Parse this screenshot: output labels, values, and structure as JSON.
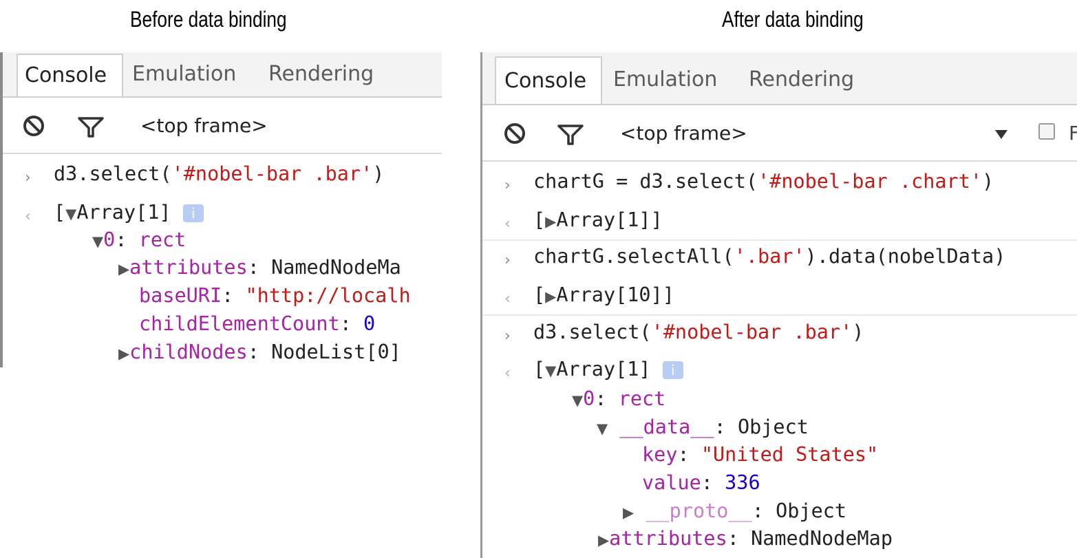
{
  "captions": {
    "before": "Before data binding",
    "after": "After data binding"
  },
  "tabs": [
    "Console",
    "Emulation",
    "Rendering"
  ],
  "toolbar": {
    "frame": "<top frame>",
    "icons": [
      "clear-console-icon",
      "filter-icon"
    ],
    "dropdown_icon": "dropdown-triangle-icon",
    "checkbox_partial_label": "F"
  },
  "left_console": {
    "cmd": "d3.select(",
    "cmd_arg": "'#nobel-bar .bar'",
    "cmd_end": ")",
    "result_array": "Array[1]",
    "item0_key": "0",
    "item0_val": "rect",
    "attributes_key": "attributes",
    "attributes_val": "NamedNodeMa",
    "baseuri_key": "baseURI",
    "baseuri_val": "\"http://localh",
    "childcount_key": "childElementCount",
    "childcount_val": "0",
    "childnodes_key": "childNodes",
    "childnodes_val": "NodeList[0]"
  },
  "right_console": {
    "cmd1": "chartG = d3.select(",
    "cmd1_arg": "'#nobel-bar .chart'",
    "cmd1_end": ")",
    "res1": "Array[1]]",
    "cmd2": "chartG.selectAll(",
    "cmd2_arg": "'.bar'",
    "cmd2_end": ").data(nobelData)",
    "res2": "Array[10]]",
    "cmd3": "d3.select(",
    "cmd3_arg": "'#nobel-bar .bar'",
    "cmd3_end": ")",
    "res3": "Array[1]",
    "item0_key": "0",
    "item0_val": "rect",
    "data_key": "__data__",
    "data_val": "Object",
    "key_key": "key",
    "key_val": "\"United States\"",
    "value_key": "value",
    "value_val": "336",
    "proto_key": "__proto__",
    "proto_val": "Object",
    "attributes_key": "attributes",
    "attributes_val": "NamedNodeMap"
  }
}
